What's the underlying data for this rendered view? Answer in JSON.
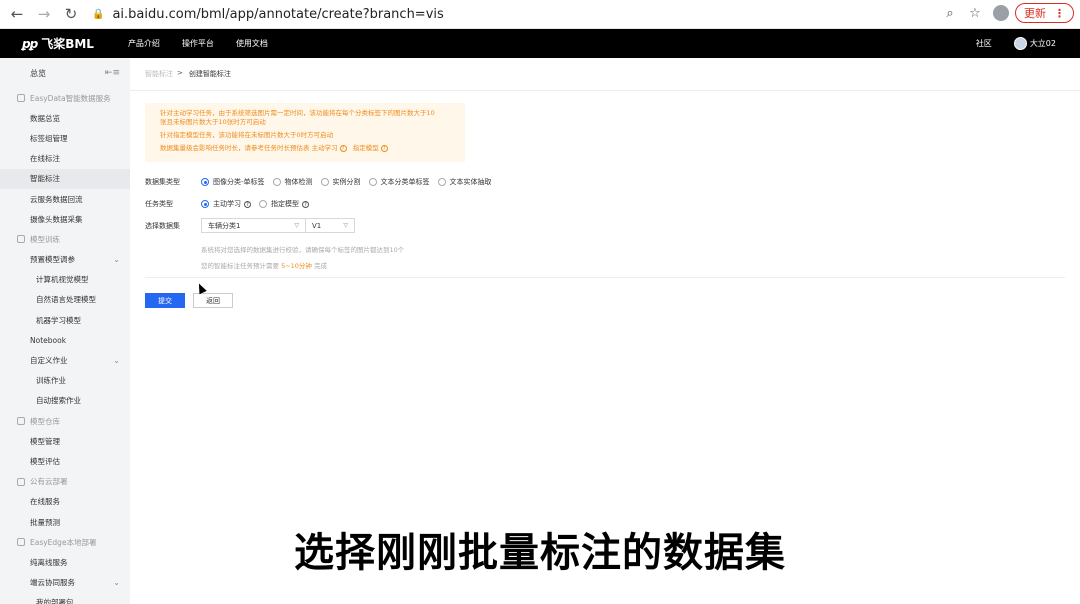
{
  "browser": {
    "url": "ai.baidu.com/bml/app/annotate/create?branch=vis",
    "update_label": "更新"
  },
  "topnav": {
    "logo_text": "飞桨BML",
    "links": [
      "产品介绍",
      "操作平台",
      "使用文档"
    ],
    "community": "社区",
    "user": "大立02"
  },
  "sidebar": {
    "overview": "总览",
    "items": [
      {
        "label": "EasyData智能数据服务",
        "type": "group"
      },
      {
        "label": "数据总览",
        "type": "item"
      },
      {
        "label": "标签组管理",
        "type": "item"
      },
      {
        "label": "在线标注",
        "type": "item"
      },
      {
        "label": "智能标注",
        "type": "item",
        "active": true
      },
      {
        "label": "云服务数据回流",
        "type": "item"
      },
      {
        "label": "摄像头数据采集",
        "type": "item"
      },
      {
        "label": "模型训练",
        "type": "group"
      },
      {
        "label": "预置模型调参",
        "type": "item",
        "chevron": true
      },
      {
        "label": "计算机视觉模型",
        "type": "sub"
      },
      {
        "label": "自然语言处理模型",
        "type": "sub"
      },
      {
        "label": "机器学习模型",
        "type": "sub"
      },
      {
        "label": "Notebook",
        "type": "item"
      },
      {
        "label": "自定义作业",
        "type": "item",
        "chevron": true
      },
      {
        "label": "训练作业",
        "type": "sub"
      },
      {
        "label": "自动搜索作业",
        "type": "sub"
      },
      {
        "label": "模型仓库",
        "type": "group"
      },
      {
        "label": "模型管理",
        "type": "item"
      },
      {
        "label": "模型评估",
        "type": "item"
      },
      {
        "label": "公有云部署",
        "type": "group"
      },
      {
        "label": "在线服务",
        "type": "item"
      },
      {
        "label": "批量预测",
        "type": "item"
      },
      {
        "label": "EasyEdge本地部署",
        "type": "group"
      },
      {
        "label": "纯离线服务",
        "type": "item"
      },
      {
        "label": "端云协同服务",
        "type": "item",
        "chevron": true
      },
      {
        "label": "我的部署包",
        "type": "sub"
      }
    ]
  },
  "breadcrumb": {
    "parent": "智能标注",
    "separator": ">",
    "current": "创建智能标注"
  },
  "notice": {
    "line1": "针对主动学习任务，由于系统筛选图片需一定时间，该功能将在每个分类标签下的图片数大于10",
    "line2": "张且未标图片数大于10张时方可启动",
    "line3": "针对指定模型任务，该功能将在未标图片数大于0时方可启动",
    "line4_text": "数据集量级会影响任务时长，请参考任务时长预估表",
    "link1": "主动学习",
    "link2": "指定模型"
  },
  "form": {
    "dataset_type_label": "数据集类型",
    "dataset_types": [
      "图像分类-单标签",
      "物体检测",
      "实例分割",
      "文本分类单标签",
      "文本实体抽取"
    ],
    "task_type_label": "任务类型",
    "task_types": [
      "主动学习",
      "指定模型"
    ],
    "select_dataset_label": "选择数据集",
    "dataset_value": "车辆分类1",
    "version_value": "V1",
    "hint1": "系统将对您选择的数据集进行校验，请确保每个标签的图片都达到10个",
    "hint2_prefix": "您的智能标注任务预计需要",
    "hint2_time": "5~10分钟",
    "hint2_suffix": "完成"
  },
  "buttons": {
    "submit": "提交",
    "back": "返回"
  },
  "subtitle": "选择刚刚批量标注的数据集"
}
